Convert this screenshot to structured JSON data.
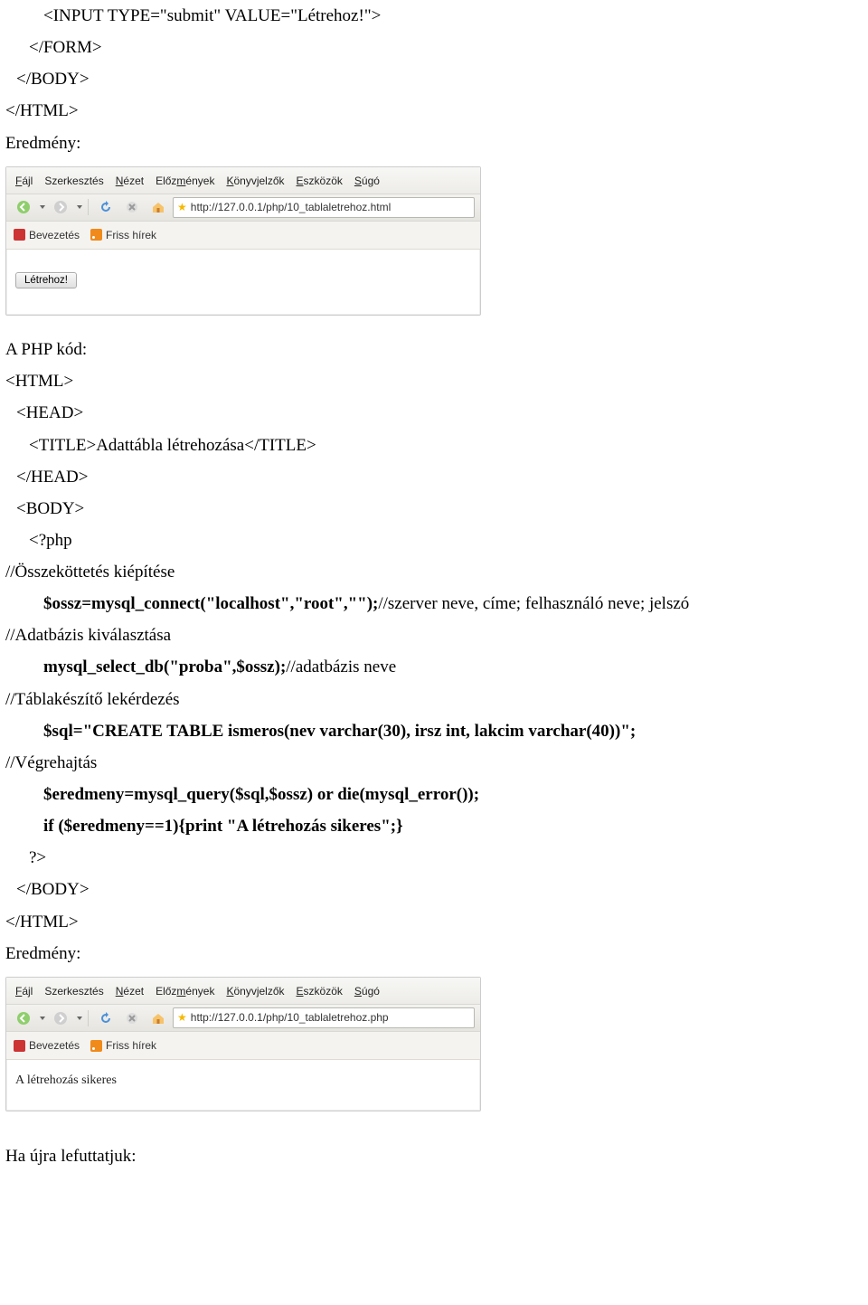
{
  "code_top": {
    "l1": "<INPUT TYPE=\"submit\" VALUE=\"Létrehoz!\">",
    "l2": "</FORM>",
    "l3": "</BODY>",
    "l4": "</HTML>",
    "result_label": "Eredmény:"
  },
  "browser": {
    "menu": {
      "file": "Fájl",
      "edit": "Szerkesztés",
      "view": "Nézet",
      "history": "Előzmények",
      "bookmarks": "Könyvjelzők",
      "tools": "Eszközök",
      "help": "Súgó"
    },
    "bookmarks": {
      "intro": "Bevezetés",
      "news": "Friss hírek"
    }
  },
  "browser1": {
    "url": "http://127.0.0.1/php/10_tablaletrehoz.html",
    "button_label": "Létrehoz!"
  },
  "section2": {
    "heading": "A PHP kód:",
    "l1": "<HTML>",
    "l2": "<HEAD>",
    "l3_a": "<TITLE>",
    "l3_b": "Adattábla létrehozása",
    "l3_c": "</TITLE>",
    "l4": "</HEAD>",
    "l5": "<BODY>",
    "l6": "<?php",
    "c1": "//Összeköttetés kiépítése",
    "l7_bold": "$ossz=mysql_connect(\"localhost\",\"root\",\"\");",
    "l7_tail": "//szerver neve, címe; felhasználó neve; jelszó",
    "c2": "//Adatbázis kiválasztása",
    "l8_bold": "mysql_select_db(\"proba\",$ossz);",
    "l8_tail": "//adatbázis neve",
    "c3": "//Táblakészítő lekérdezés",
    "l9_bold": "$sql=\"CREATE TABLE ismeros(nev varchar(30), irsz int, lakcim varchar(40))\";",
    "c4": "//Végrehajtás",
    "l10_bold": "$eredmeny=mysql_query($sql,$ossz) or die(mysql_error());",
    "l11_bold": "if ($eredmeny==1){print \"A létrehozás sikeres\";}",
    "l12": "?>",
    "l13": "</BODY>",
    "l14": "</HTML>",
    "result_label": "Eredmény:"
  },
  "browser2": {
    "url": "http://127.0.0.1/php/10_tablaletrehoz.php",
    "output": "A létrehozás sikeres"
  },
  "footer": {
    "rerun": "Ha újra lefuttatjuk:"
  }
}
